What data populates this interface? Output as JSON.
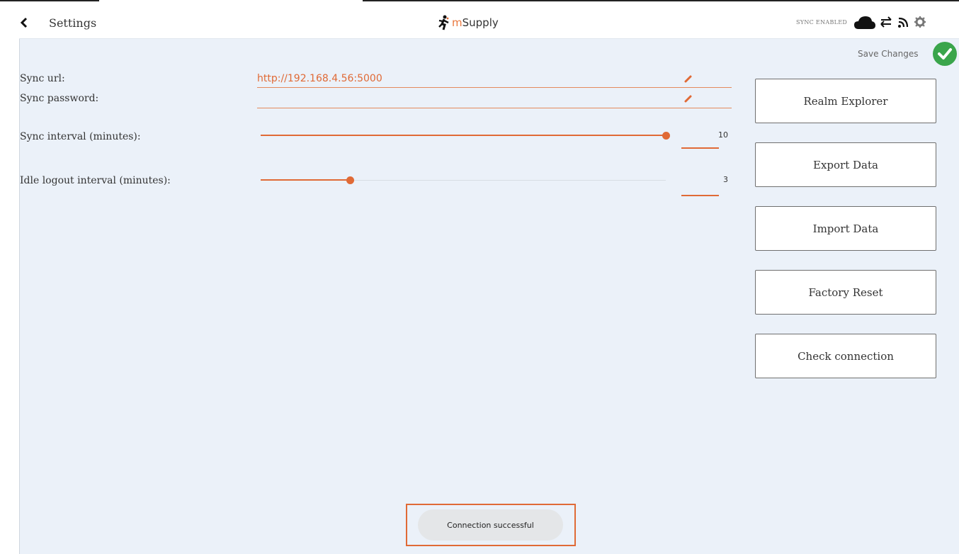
{
  "header": {
    "title": "Settings",
    "back_icon": "chevron-left-icon",
    "logo": {
      "prefix": "m",
      "suffix": "Supply"
    },
    "sync_status": "SYNC ENABLED",
    "icons": [
      "cloud-icon",
      "sync-arrows-icon",
      "signal-icon",
      "gear-icon"
    ]
  },
  "save": {
    "label": "Save Changes",
    "icon": "check-circle-icon"
  },
  "form": {
    "sync_url_label": "Sync url:",
    "sync_url_value": "http://192.168.4.56:5000",
    "sync_password_label": "Sync password:",
    "sync_password_value": "",
    "sync_interval_label": "Sync interval (minutes):",
    "sync_interval_value": "10",
    "sync_interval_fraction": 1.0,
    "idle_logout_label": "Idle logout interval (minutes):",
    "idle_logout_value": "3",
    "idle_logout_fraction": 0.22
  },
  "buttons": {
    "realm_explorer": "Realm Explorer",
    "export_data": "Export Data",
    "import_data": "Import Data",
    "factory_reset": "Factory Reset",
    "check_connection": "Check connection"
  },
  "toast": {
    "message": "Connection successful"
  },
  "colors": {
    "accent": "#e06a36",
    "background": "#ebf1f9",
    "success": "#3aa54b"
  }
}
